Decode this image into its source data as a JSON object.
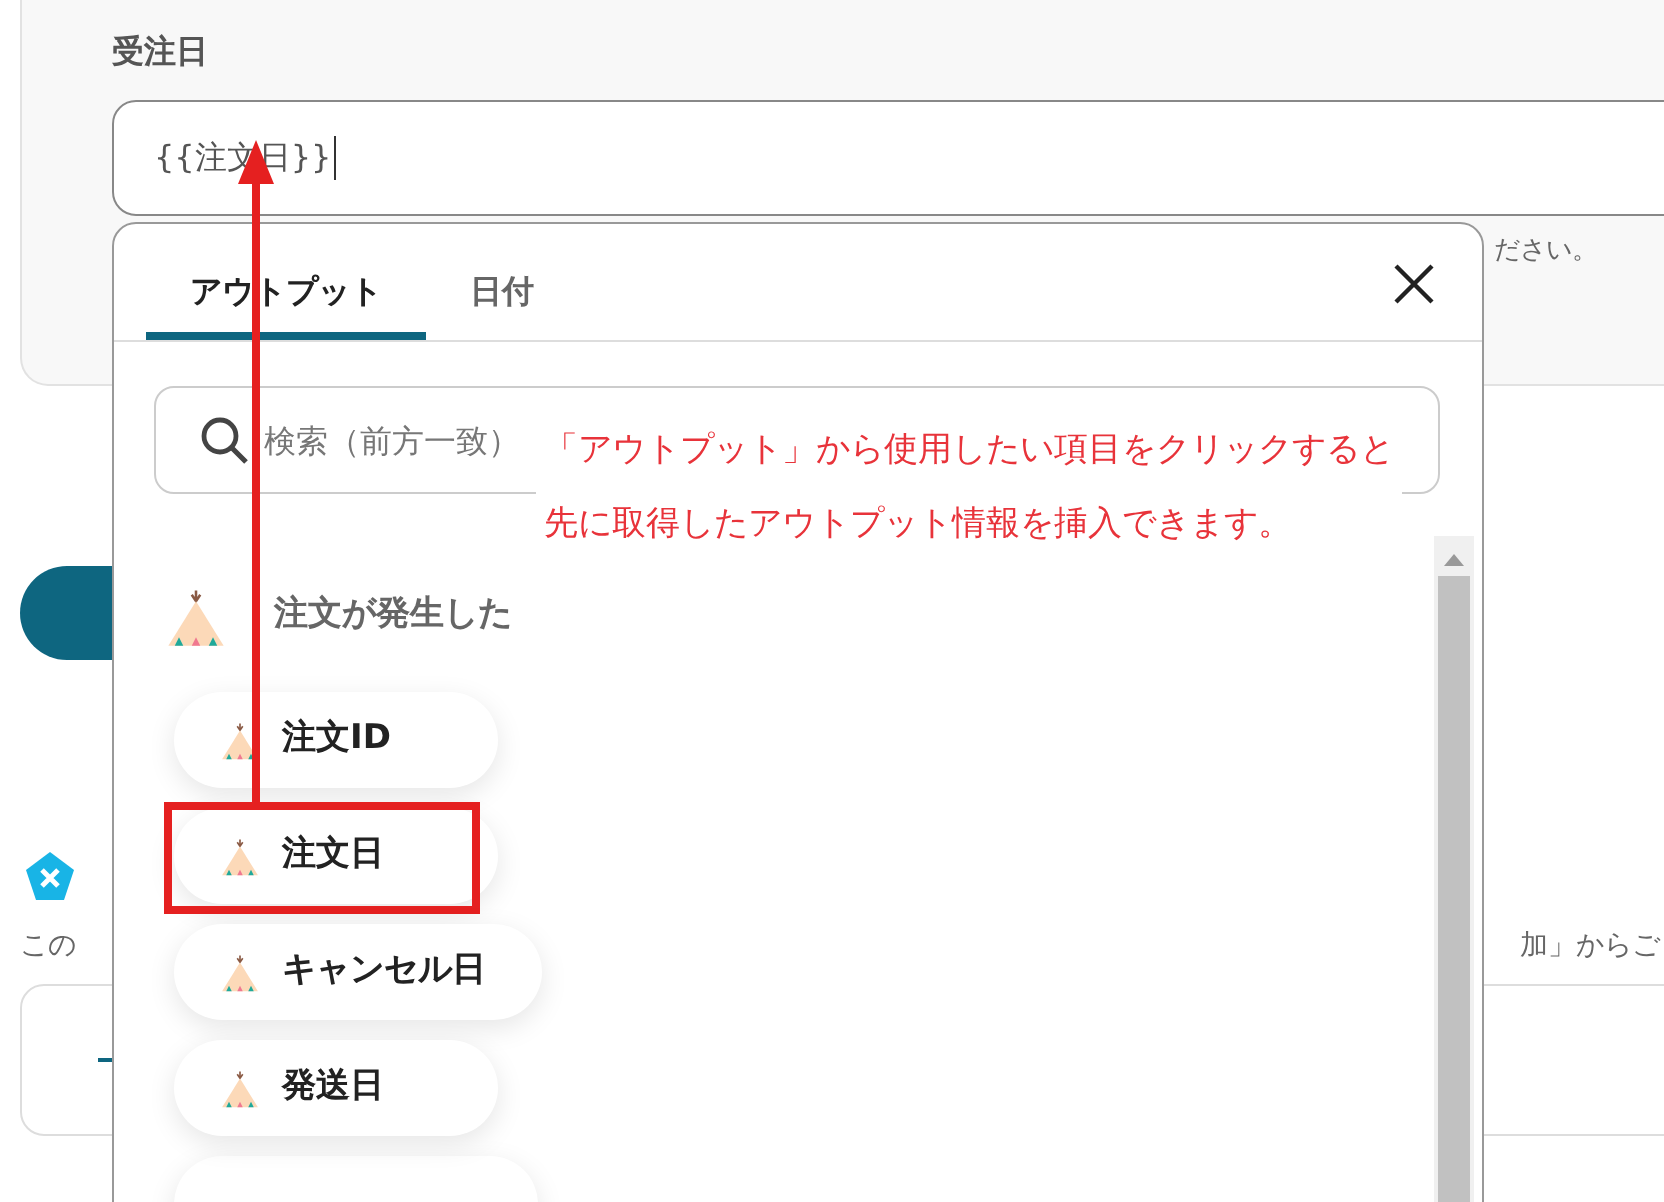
{
  "form": {
    "label": "受注日",
    "value": "{{注文日}}",
    "hint": "ださい。"
  },
  "section": {
    "description_left": "この",
    "description_right": "加」からご"
  },
  "popup": {
    "tabs": [
      {
        "label": "アウトプット",
        "selected": true
      },
      {
        "label": "日付",
        "selected": false
      }
    ],
    "search": {
      "placeholder": "検索（前方一致）"
    },
    "group": {
      "title": "注文が発生した",
      "items": [
        {
          "label": "注文ID",
          "highlighted": false
        },
        {
          "label": "注文日",
          "highlighted": true
        },
        {
          "label": "キャンセル日",
          "highlighted": false
        },
        {
          "label": "発送日",
          "highlighted": false
        }
      ]
    }
  },
  "annotation": {
    "lines": [
      "「アウトプット」から使用したい項目をクリックすると",
      "先に取得したアウトプット情報を挿入できます。"
    ]
  }
}
